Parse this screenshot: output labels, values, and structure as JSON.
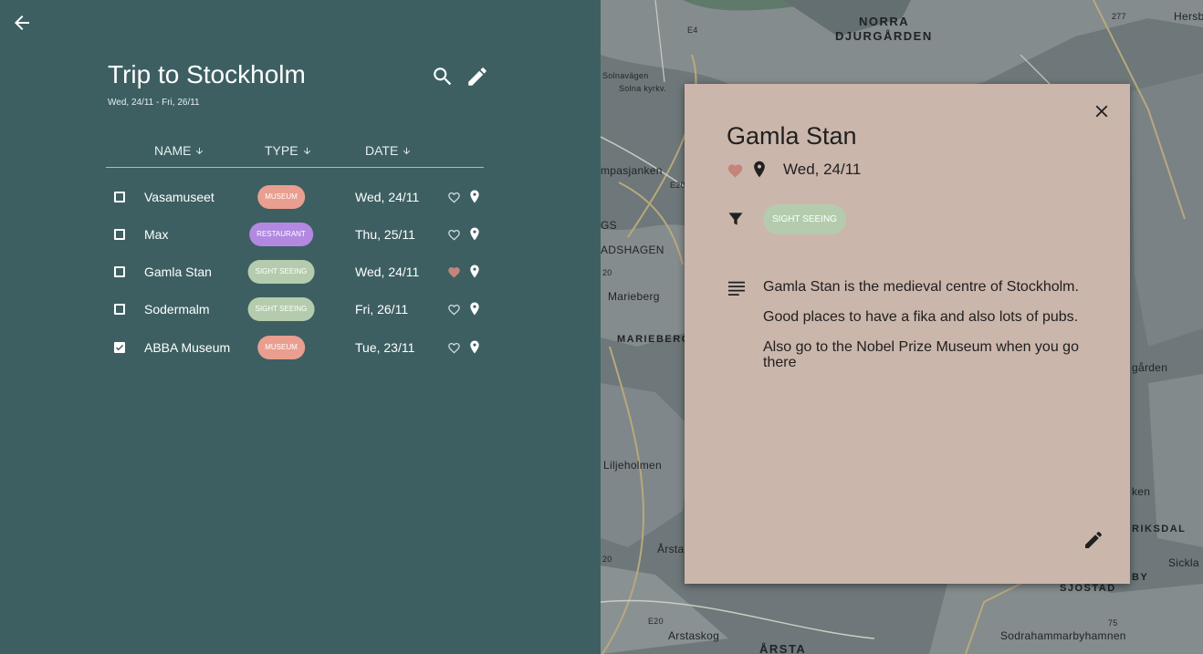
{
  "header": {
    "title": "Trip to Stockholm",
    "dates": "Wed, 24/11 - Fri, 26/11"
  },
  "icons": {
    "back": "arrow-left-icon",
    "search": "search-icon",
    "edit": "pencil-icon",
    "sort": "arrow-down-icon",
    "favorite": "heart-icon",
    "location": "map-pin-icon",
    "close": "close-icon",
    "type": "filter-icon",
    "notes": "notes-icon"
  },
  "table": {
    "columns": [
      {
        "label": "NAME"
      },
      {
        "label": "TYPE"
      },
      {
        "label": "DATE"
      }
    ],
    "rows": [
      {
        "name": "Vasamuseet",
        "type": "MUSEUM",
        "type_color": "#e99e8f",
        "date": "Wed, 24/11",
        "favorite": false,
        "checked": false
      },
      {
        "name": "Max",
        "type": "RESTAURANT",
        "type_color": "#b388e0",
        "date": "Thu, 25/11",
        "favorite": false,
        "checked": false
      },
      {
        "name": "Gamla Stan",
        "type": "SIGHT SEEING",
        "type_color": "#b4ccad",
        "date": "Wed, 24/11",
        "favorite": true,
        "checked": false
      },
      {
        "name": "Sodermalm",
        "type": "SIGHT SEEING",
        "type_color": "#b4ccad",
        "date": "Fri, 26/11",
        "favorite": false,
        "checked": false
      },
      {
        "name": "ABBA Museum",
        "type": "MUSEUM",
        "type_color": "#e99e8f",
        "date": "Tue, 23/11",
        "favorite": false,
        "checked": true
      }
    ]
  },
  "colors": {
    "panel": "#3d5f62",
    "card": "#cbb6ac",
    "favorite": "#c4847a",
    "sight_seeing": "#b4ccad"
  },
  "map": {
    "labels": [
      "NORRA",
      "DJURGÅRDEN",
      "Hersby",
      "E4",
      "277",
      "Solna kyrkv.",
      "Solnavägen",
      "mpasjanken",
      "E20",
      "GS",
      "ADSHAGEN",
      "Marieberg",
      "MARIEBERG",
      "Liljeholmen",
      "Årsta",
      "Arstaskog",
      "ÅRSTA",
      "E20",
      "75",
      "Sodrahammarbyhamnen",
      "SJÖSTAD",
      "Sickla",
      "RIKSDAL",
      "ken",
      "gården",
      "BY",
      "20",
      "20"
    ]
  },
  "detail": {
    "title": "Gamla Stan",
    "date": "Wed, 24/11",
    "favorite": true,
    "type": "SIGHT SEEING",
    "notes": [
      "Gamla Stan is the medieval centre of Stockholm.",
      "Good places to have a fika and also lots of pubs.",
      "Also go to the Nobel Prize Museum when you go there"
    ]
  }
}
